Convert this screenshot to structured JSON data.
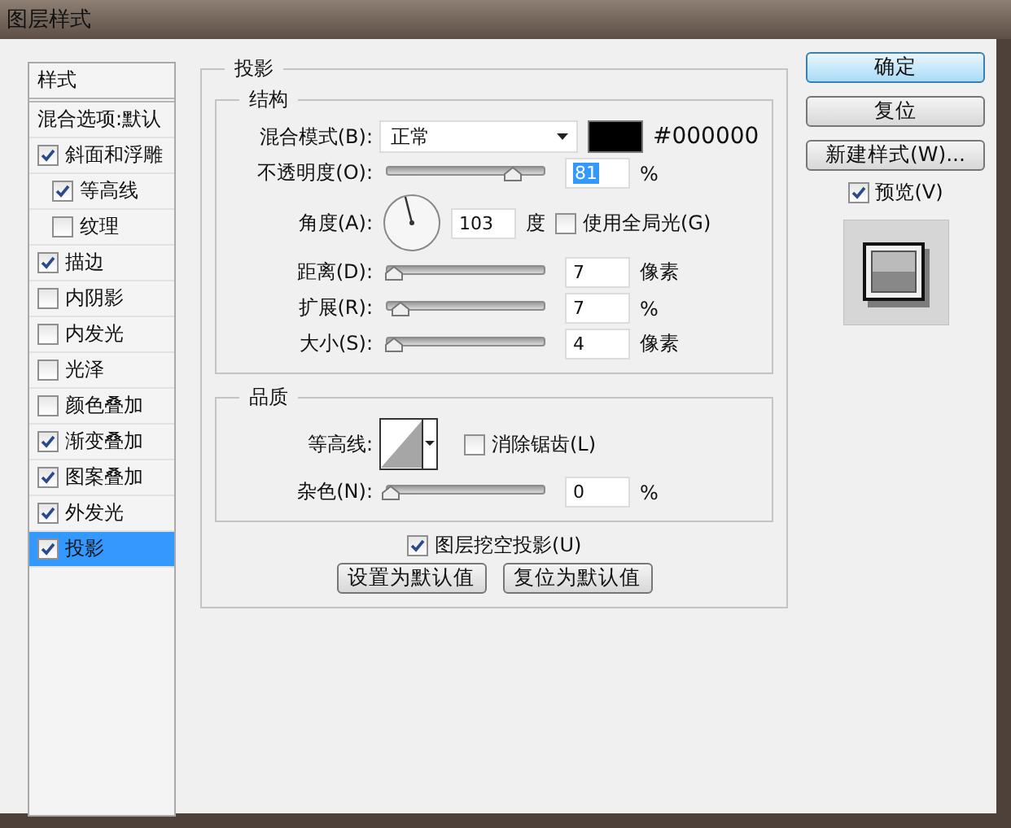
{
  "window": {
    "title": "图层样式"
  },
  "styles_list": {
    "header": "样式",
    "items": [
      {
        "label": "混合选项:默认",
        "kind": "plain",
        "selected": false
      },
      {
        "label": "斜面和浮雕",
        "kind": "check",
        "checked": true,
        "selected": false,
        "children": [
          {
            "label": "等高线",
            "kind": "check",
            "checked": true,
            "selected": false
          },
          {
            "label": "纹理",
            "kind": "check",
            "checked": false,
            "selected": false
          }
        ]
      },
      {
        "label": "描边",
        "kind": "check",
        "checked": true,
        "selected": false
      },
      {
        "label": "内阴影",
        "kind": "check",
        "checked": false,
        "selected": false
      },
      {
        "label": "内发光",
        "kind": "check",
        "checked": false,
        "selected": false
      },
      {
        "label": "光泽",
        "kind": "check",
        "checked": false,
        "selected": false
      },
      {
        "label": "颜色叠加",
        "kind": "check",
        "checked": false,
        "selected": false
      },
      {
        "label": "渐变叠加",
        "kind": "check",
        "checked": true,
        "selected": false
      },
      {
        "label": "图案叠加",
        "kind": "check",
        "checked": true,
        "selected": false
      },
      {
        "label": "外发光",
        "kind": "check",
        "checked": true,
        "selected": false
      },
      {
        "label": "投影",
        "kind": "check",
        "checked": true,
        "selected": true
      }
    ]
  },
  "drop_shadow": {
    "title": "投影",
    "structure": {
      "title": "结构",
      "blend_mode": {
        "label": "混合模式(B):",
        "value": "正常",
        "hex": "#000000"
      },
      "opacity": {
        "label": "不透明度(O):",
        "level": 0.81,
        "value": "81",
        "highlighted": true,
        "unit": "%"
      },
      "angle": {
        "label": "角度(A):",
        "value": "103",
        "unit": "度",
        "global_light": {
          "label": "使用全局光(G)",
          "checked": false
        }
      },
      "sliders": [
        {
          "label": "距离(D):",
          "level": 0.02,
          "value": "7",
          "unit": "像素"
        },
        {
          "label": "扩展(R):",
          "level": 0.07,
          "value": "7",
          "unit": "%"
        },
        {
          "label": "大小(S):",
          "level": 0.02,
          "value": "4",
          "unit": "像素"
        }
      ]
    },
    "quality": {
      "title": "品质",
      "contour": {
        "label": "等高线:"
      },
      "anti_alias": {
        "label": "消除锯齿(L)",
        "checked": false
      },
      "noise": {
        "label": "杂色(N):",
        "level": 0,
        "value": "0",
        "unit": "%"
      }
    },
    "knockout": {
      "label": "图层挖空投影(U)",
      "checked": true
    },
    "buttons": [
      "设置为默认值",
      "复位为默认值"
    ]
  },
  "actions": {
    "buttons": [
      {
        "label": "确定",
        "default": true
      },
      {
        "label": "复位",
        "default": false
      },
      {
        "label": "新建样式(W)...",
        "default": false
      }
    ],
    "preview": {
      "label": "预览(V)",
      "checked": true
    }
  }
}
